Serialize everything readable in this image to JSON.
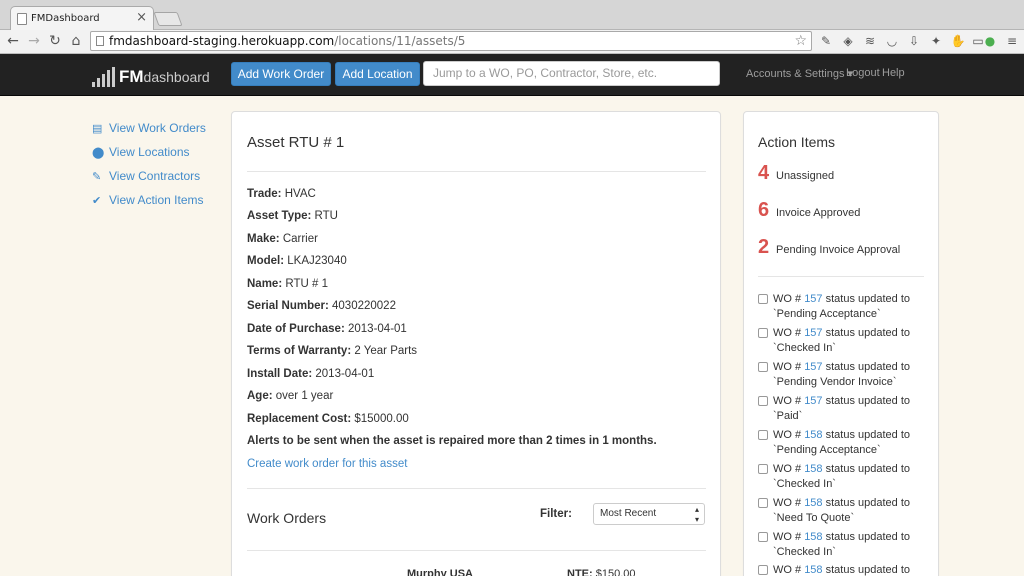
{
  "browser": {
    "tab_title": "FMDashboard",
    "url_host": "fmdashboard-staging.herokuapp.com",
    "url_path": "/locations/11/assets/5"
  },
  "header": {
    "logo_fm": "FM",
    "logo_dash": "dashboard",
    "add_work_order": "Add Work Order",
    "add_location": "Add Location",
    "jump_placeholder": "Jump to a WO, PO, Contractor, Store, etc.",
    "accounts_settings": "Accounts & Settings",
    "logout": "Logout",
    "help": "Help"
  },
  "sidebar": {
    "items": [
      {
        "label": "View Work Orders",
        "icon": "list-icon"
      },
      {
        "label": "View Locations",
        "icon": "map-marker-icon"
      },
      {
        "label": "View Contractors",
        "icon": "wrench-icon"
      },
      {
        "label": "View Action Items",
        "icon": "checkmark-icon"
      }
    ]
  },
  "asset": {
    "title": "Asset RTU # 1",
    "fields": [
      {
        "label": "Trade:",
        "value": "HVAC"
      },
      {
        "label": "Asset Type:",
        "value": "RTU"
      },
      {
        "label": "Make:",
        "value": "Carrier"
      },
      {
        "label": "Model:",
        "value": "LKAJ23040"
      },
      {
        "label": "Name:",
        "value": "RTU # 1"
      },
      {
        "label": "Serial Number:",
        "value": "4030220022"
      },
      {
        "label": "Date of Purchase:",
        "value": "2013-04-01"
      },
      {
        "label": "Terms of Warranty:",
        "value": "2 Year Parts"
      },
      {
        "label": "Install Date:",
        "value": "2013-04-01"
      },
      {
        "label": "Age:",
        "value": "over 1 year"
      },
      {
        "label": "Replacement Cost:",
        "value": "$15000.00"
      }
    ],
    "alert": "Alerts to be sent when the asset is repaired more than 2 times in 1 months.",
    "create_link": "Create work order for this asset"
  },
  "work_orders": {
    "title": "Work Orders",
    "filter_label": "Filter:",
    "filter_value": "Most Recent",
    "peek_store": "Murphy USA",
    "peek_nte_label": "NTE:",
    "peek_nte_value": "$150.00"
  },
  "action_items": {
    "title": "Action Items",
    "stats": [
      {
        "num": "4",
        "label": "Unassigned"
      },
      {
        "num": "6",
        "label": "Invoice Approved"
      },
      {
        "num": "2",
        "label": "Pending Invoice Approval"
      }
    ],
    "updates": [
      {
        "prefix": "WO #",
        "wo": "157",
        "mid": "status updated to",
        "status": "`Pending Acceptance`"
      },
      {
        "prefix": "WO #",
        "wo": "157",
        "mid": "status updated to",
        "status": "`Checked In`"
      },
      {
        "prefix": "WO #",
        "wo": "157",
        "mid": "status updated to",
        "status": "`Pending Vendor Invoice`"
      },
      {
        "prefix": "WO #",
        "wo": "157",
        "mid": "status updated to",
        "status": "`Paid`"
      },
      {
        "prefix": "WO #",
        "wo": "158",
        "mid": "status updated to",
        "status": "`Pending Acceptance`"
      },
      {
        "prefix": "WO #",
        "wo": "158",
        "mid": "status updated to",
        "status": "`Checked In`"
      },
      {
        "prefix": "WO #",
        "wo": "158",
        "mid": "status updated to",
        "status": "`Need To Quote`"
      },
      {
        "prefix": "WO #",
        "wo": "158",
        "mid": "status updated to",
        "status": "`Checked In`"
      },
      {
        "prefix": "WO #",
        "wo": "158",
        "mid": "status updated to",
        "status": ""
      }
    ]
  }
}
